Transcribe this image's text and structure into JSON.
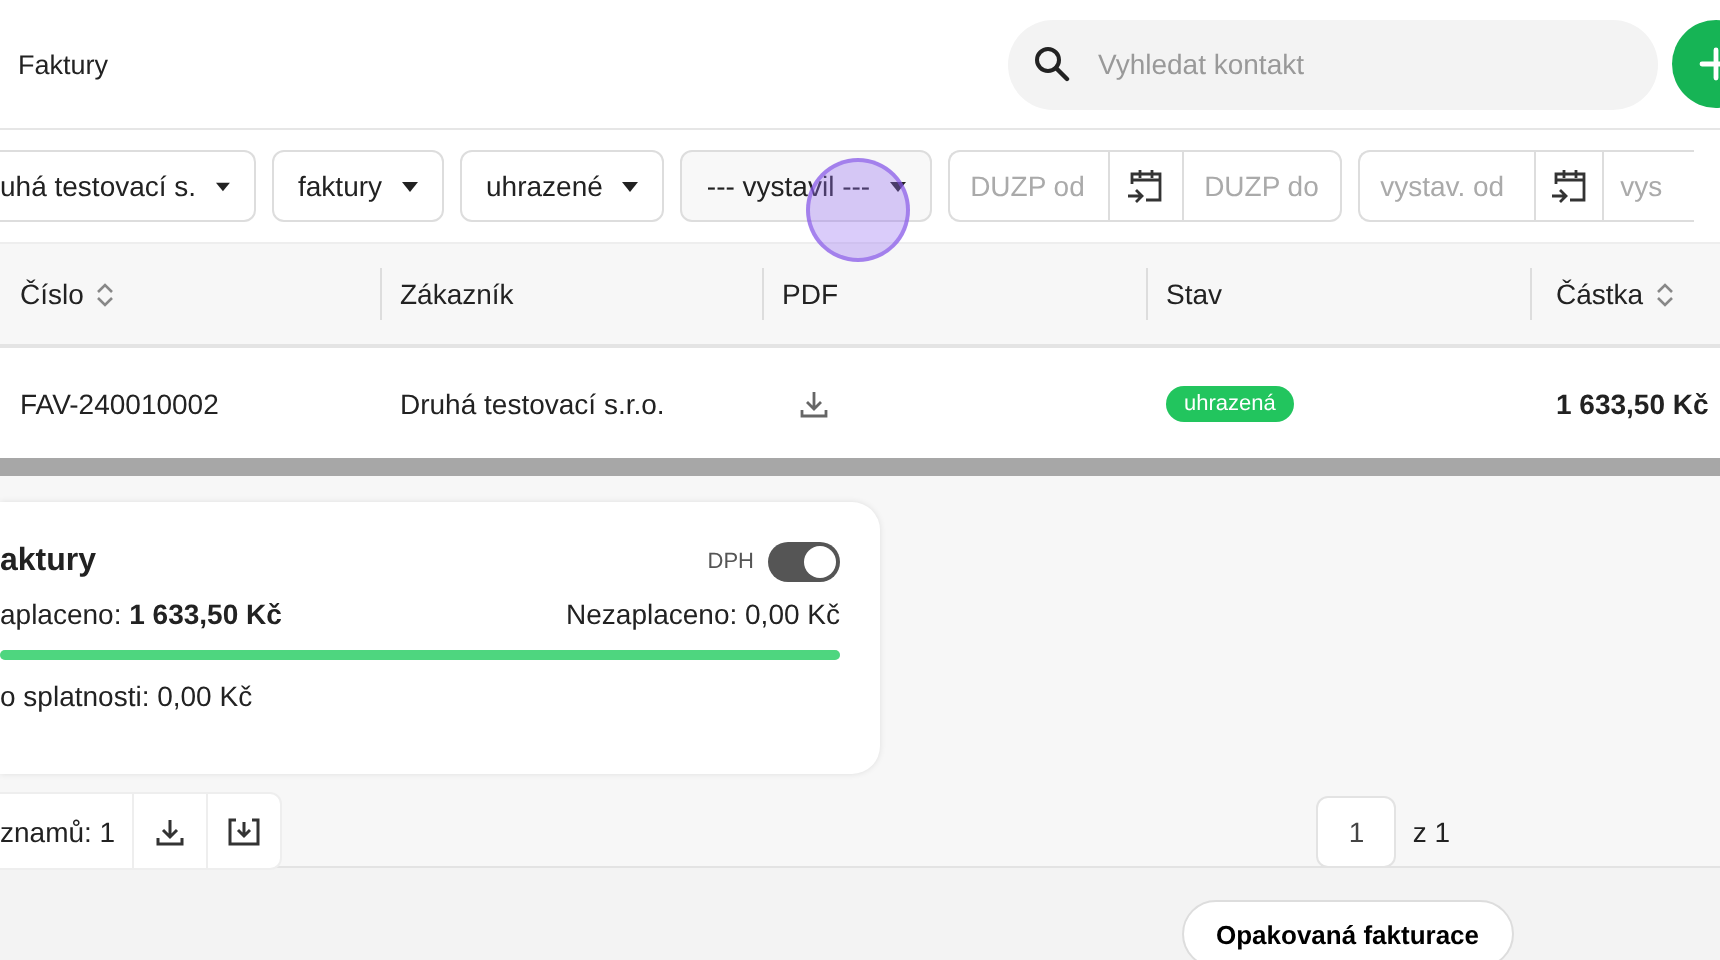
{
  "header": {
    "title": "Faktury",
    "search": {
      "placeholder": "Vyhledat kontakt"
    }
  },
  "filters": [
    {
      "kind": "select",
      "value": "uhá testovací s."
    },
    {
      "kind": "select",
      "value": "faktury"
    },
    {
      "kind": "select",
      "value": "uhrazené"
    },
    {
      "kind": "select",
      "value": "--- vystavil ---"
    },
    {
      "kind": "daterange",
      "from": {
        "placeholder": "DUZP od"
      },
      "to": {
        "placeholder": "DUZP do"
      }
    },
    {
      "kind": "daterange",
      "from": {
        "placeholder": "vystav. od"
      },
      "to": {
        "placeholder": "vys"
      }
    }
  ],
  "table": {
    "columns": [
      {
        "label": "Číslo",
        "sortable": true
      },
      {
        "label": "Zákazník",
        "sortable": false
      },
      {
        "label": "PDF",
        "sortable": false
      },
      {
        "label": "Stav",
        "sortable": false
      },
      {
        "label": "Částka",
        "sortable": true
      }
    ],
    "rows": [
      {
        "number": "FAV-240010002",
        "customer": "Druhá testovací s.r.o.",
        "status": {
          "label": "uhrazená",
          "color": "#22c55e"
        },
        "amount": "1 633,50 Kč"
      }
    ]
  },
  "summary": {
    "title": "aktury",
    "vat": {
      "label": "DPH",
      "on": true
    },
    "paid": "aplaceno: **1 633,50 Kč**",
    "unpaid": "Nezaplaceno: 0,00 Kč",
    "level": 1,
    "overdue": "o splatnosti: 0,00 Kč"
  },
  "footer": {
    "count": "znamů: 1",
    "page": "1",
    "of": "z 1"
  },
  "bottom_button": "Opakovaná fakturace"
}
